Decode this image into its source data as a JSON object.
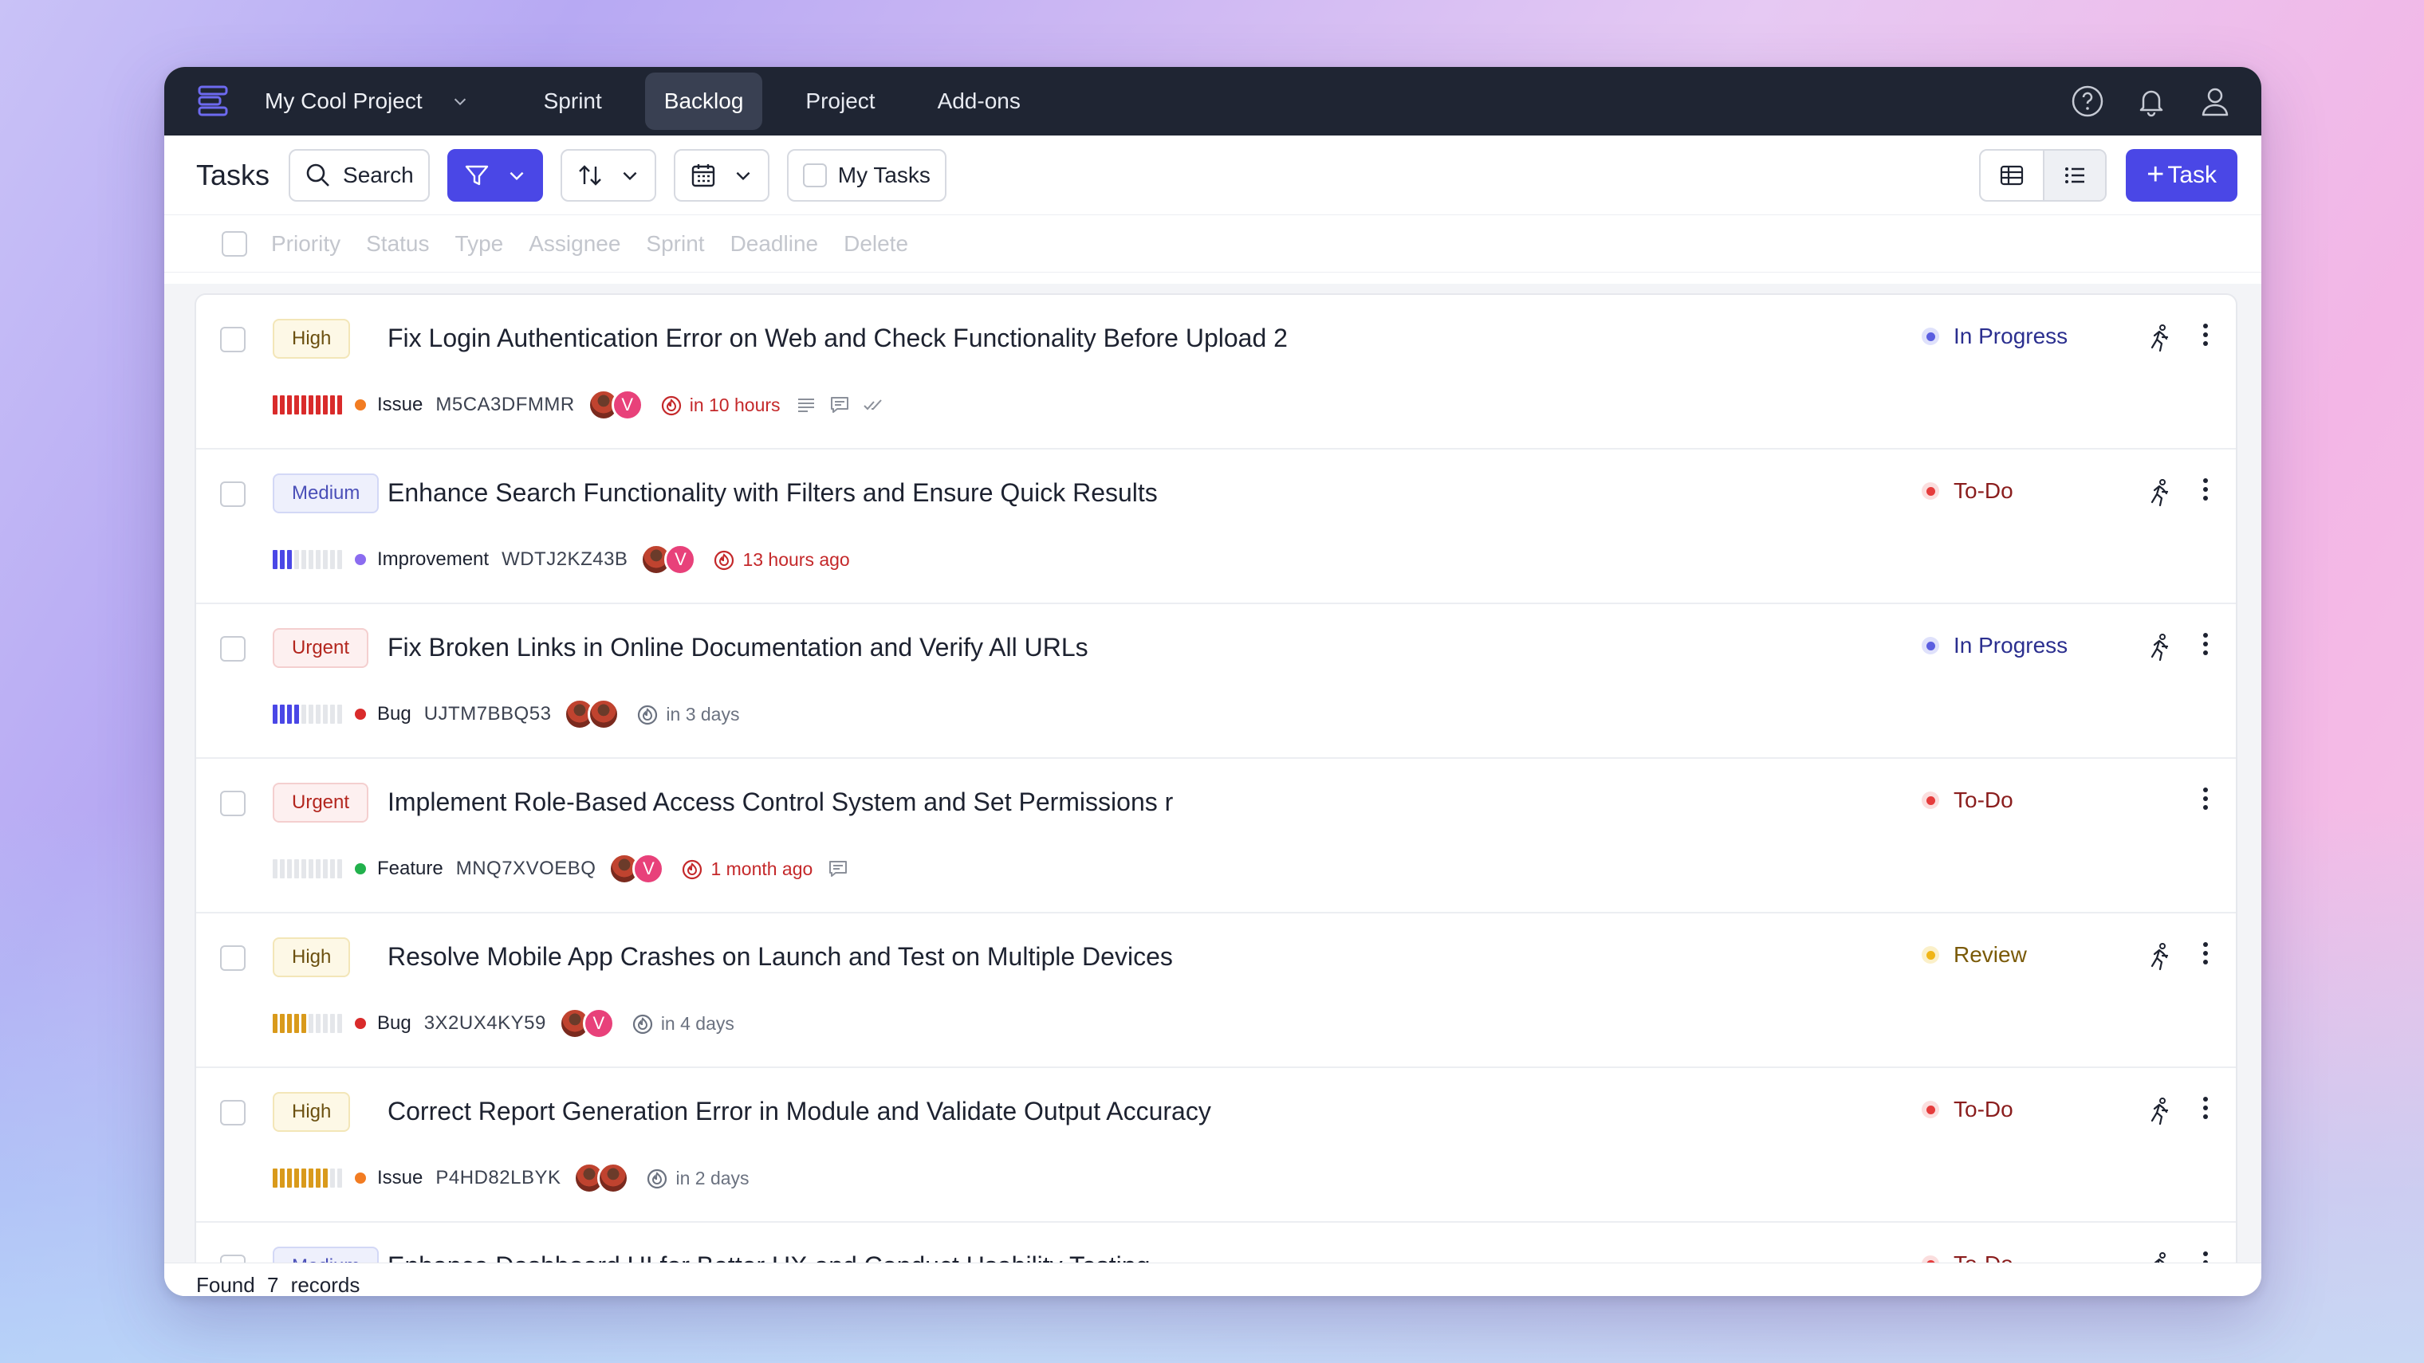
{
  "nav": {
    "project": "My Cool Project",
    "tabs": [
      {
        "label": "Sprint",
        "active": false
      },
      {
        "label": "Backlog",
        "active": true
      },
      {
        "label": "Project",
        "active": false
      },
      {
        "label": "Add-ons",
        "active": false
      }
    ],
    "icons": [
      "help-icon",
      "bell-icon",
      "user-icon"
    ]
  },
  "toolbar": {
    "title": "Tasks",
    "search_label": "Search",
    "my_tasks_label": "My Tasks",
    "add_task_label": "Task",
    "accent": "#4a47e6"
  },
  "columns": [
    "Priority",
    "Status",
    "Type",
    "Assignee",
    "Sprint",
    "Deadline",
    "Delete"
  ],
  "tasks": [
    {
      "priority": "High",
      "title": "Fix Login Authentication Error on Web and Check Functionality Before Upload 2",
      "type": "Issue",
      "type_color": "#f27c22",
      "code": "M5CA3DFMMR",
      "due": "in 10 hours",
      "due_urgent": true,
      "status": "In Progress",
      "progress": 1.0,
      "progress_color": "#d92b2b"
    },
    {
      "priority": "Medium",
      "title": "Enhance Search Functionality with Filters and Ensure Quick Results",
      "type": "Improvement",
      "type_color": "#8b6cf0",
      "code": "WDTJ2KZ43B",
      "due": "13 hours ago",
      "due_urgent": true,
      "status": "To-Do",
      "progress": 0.3,
      "progress_color": "#4a47e6"
    },
    {
      "priority": "Urgent",
      "title": "Fix Broken Links in Online Documentation and Verify All URLs",
      "type": "Bug",
      "type_color": "#d92b2b",
      "code": "UJTM7BBQ53",
      "due": "in 3 days",
      "due_urgent": false,
      "status": "In Progress",
      "progress": 0.4,
      "progress_color": "#4a47e6"
    },
    {
      "priority": "Urgent",
      "title": "Implement Role-Based Access Control System and Set Permissions r",
      "type": "Feature",
      "type_color": "#22b14c",
      "code": "MNQ7XVOEBQ",
      "due": "1 month ago",
      "due_urgent": true,
      "status": "To-Do",
      "progress": 0,
      "progress_color": "#4a47e6"
    },
    {
      "priority": "High",
      "title": "Resolve Mobile App Crashes on Launch and Test on Multiple Devices",
      "type": "Bug",
      "type_color": "#d92b2b",
      "code": "3X2UX4KY59",
      "due": "in 4 days",
      "due_urgent": false,
      "status": "Review",
      "progress": 0.5,
      "progress_color": "#d99a1b"
    },
    {
      "priority": "High",
      "title": "Correct Report Generation Error in Module and Validate Output Accuracy",
      "type": "Issue",
      "type_color": "#f27c22",
      "code": "P4HD82LBYK",
      "due": "in 2 days",
      "due_urgent": false,
      "status": "To-Do",
      "progress": 0.8,
      "progress_color": "#d99a1b"
    },
    {
      "priority": "Medium",
      "title": "Enhance Dashboard UI for Better UX and Conduct Usability Testing",
      "status": "To-Do"
    }
  ],
  "footer": {
    "found": "Found",
    "count": "7",
    "records": "records"
  }
}
